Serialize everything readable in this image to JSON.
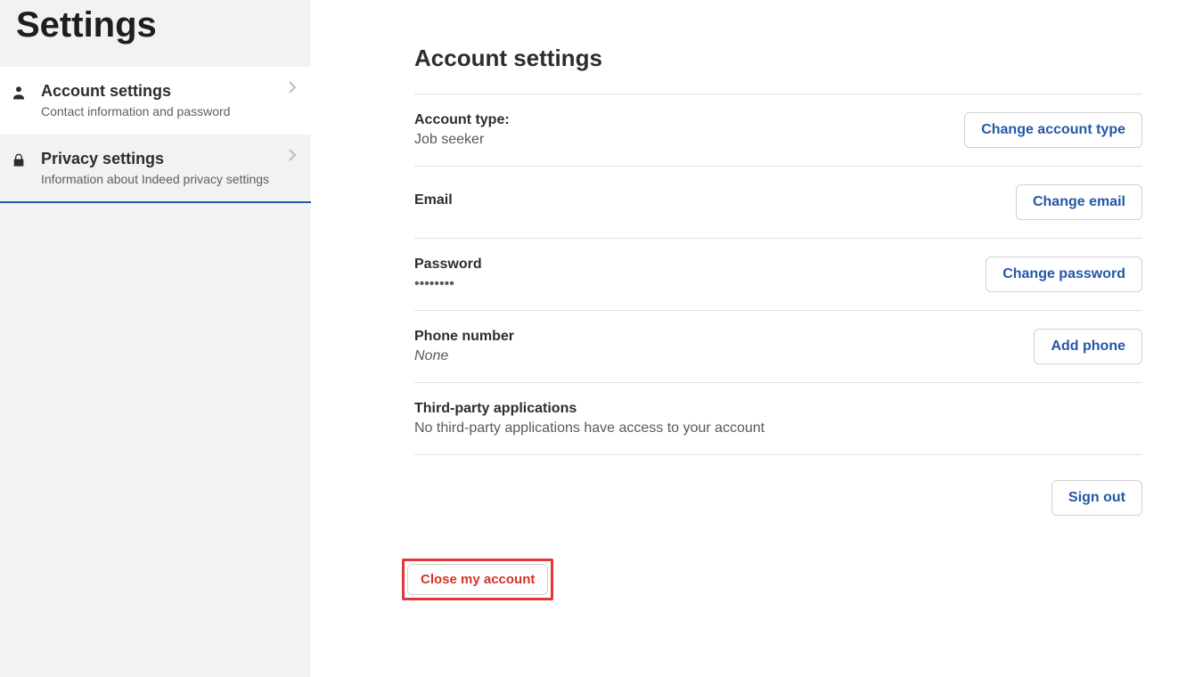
{
  "sidebar": {
    "title": "Settings",
    "items": [
      {
        "label": "Account settings",
        "sub": "Contact information and password"
      },
      {
        "label": "Privacy settings",
        "sub": "Information about Indeed privacy settings"
      }
    ]
  },
  "main": {
    "title": "Account settings",
    "rows": {
      "account_type": {
        "label": "Account type:",
        "value": "Job seeker",
        "action": "Change account type"
      },
      "email": {
        "label": "Email",
        "value": "",
        "action": "Change email"
      },
      "password": {
        "label": "Password",
        "value": "••••••••",
        "action": "Change password"
      },
      "phone": {
        "label": "Phone number",
        "value": "None",
        "action": "Add phone"
      },
      "thirdparty": {
        "label": "Third-party applications",
        "value": "No third-party applications have access to your account"
      }
    },
    "signout": "Sign out",
    "close_account": "Close my account"
  }
}
